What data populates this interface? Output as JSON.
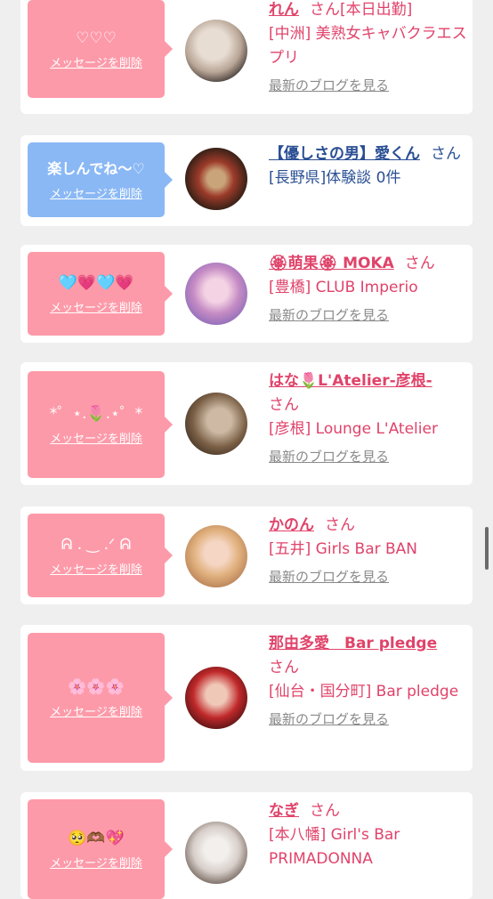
{
  "actions": {
    "delete_label": "メッセージを削除",
    "blog_label": "最新のブログを見る"
  },
  "san": "さん",
  "entries": [
    {
      "message": "♡♡♡",
      "name": "れん",
      "suffix": "[本日出勤]",
      "place": "[中洲] 美熟女キャバクラエスプリ"
    },
    {
      "message": "楽しんでね〜♡",
      "name": "【優しさの男】愛くん",
      "place": "[長野県]体験談 0件"
    },
    {
      "message": "🩵💗🩵💗",
      "name": "🏵萌果🏵 MOKA",
      "place": "[豊橋] CLUB Imperio"
    },
    {
      "message": "*゜⋆.🌷.⋆゜*",
      "name": "はな🌷L'Atelier-彦根-",
      "place": "[彦根] Lounge L'Atelier"
    },
    {
      "message": "ᕱ . ‿ .ᐟ ᕱ",
      "name": "かのん",
      "place": "[五井] Girls Bar BAN"
    },
    {
      "message": "🌸🌸🌸",
      "name": "那由多愛　Bar pledge",
      "place": "[仙台・国分町] Bar pledge"
    },
    {
      "message": "🥺🫶🏾💖",
      "name": "なぎ",
      "place": "[本八幡] Girl's Bar PRIMADONNA"
    }
  ]
}
